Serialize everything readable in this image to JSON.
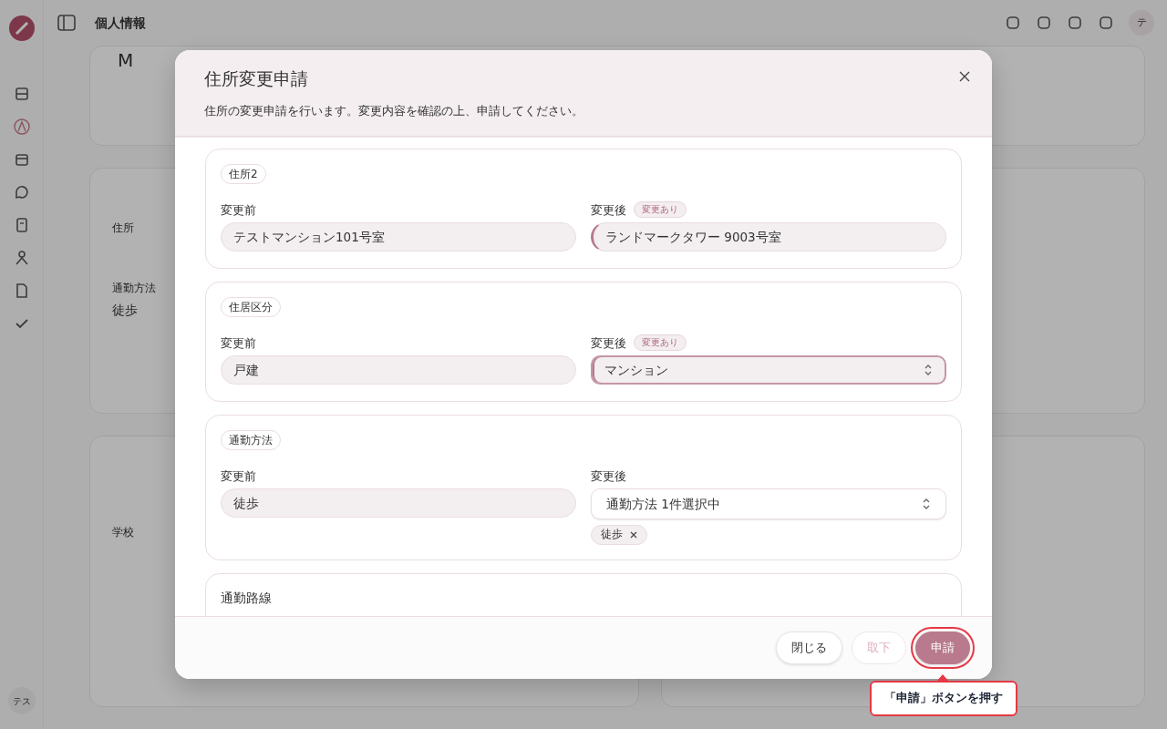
{
  "app": {
    "page_title": "個人情報",
    "avatar": "テ",
    "sidebar_user": "テス"
  },
  "background": {
    "top_card": {
      "text": "M"
    },
    "address_card": {
      "fields": [
        {
          "label": "住所"
        },
        {
          "label": "通勤方法",
          "value": "徒歩"
        }
      ]
    },
    "school_card": {
      "label": "学校"
    }
  },
  "dialog": {
    "title": "住所変更申請",
    "description": "住所の変更申請を行います。変更内容を確認の上、申請してください。",
    "sections": [
      {
        "kind": "compare",
        "label": "住所2",
        "before_label": "変更前",
        "before": "テストマンション101号室",
        "after_label": "変更後",
        "after": {
          "kind": "input",
          "value": "ランドマークタワー 9003号室"
        },
        "changed": true,
        "badge": "変更あり"
      },
      {
        "kind": "compare",
        "label": "住居区分",
        "before_label": "変更前",
        "before": "戸建",
        "after_label": "変更後",
        "after": {
          "kind": "select",
          "value": "マンション"
        },
        "changed": true,
        "badge": "変更あり"
      },
      {
        "kind": "compare",
        "label": "通勤方法",
        "before_label": "変更前",
        "before": "徒歩",
        "after_label": "変更後",
        "after": {
          "kind": "multiselect",
          "value": "通勤方法 1件選択中"
        },
        "changed": false,
        "chips": [
          "徒歩"
        ]
      },
      {
        "kind": "heading",
        "label": "通勤路線"
      }
    ],
    "buttons": [
      {
        "kind": "default",
        "label": "閉じる",
        "disabled": false,
        "highlighted": false
      },
      {
        "kind": "default",
        "label": "取下",
        "disabled": true,
        "highlighted": false
      },
      {
        "kind": "primary",
        "label": "申請",
        "disabled": false,
        "highlighted": true
      }
    ]
  },
  "callout": {
    "text": "「申請」ボタンを押す"
  }
}
